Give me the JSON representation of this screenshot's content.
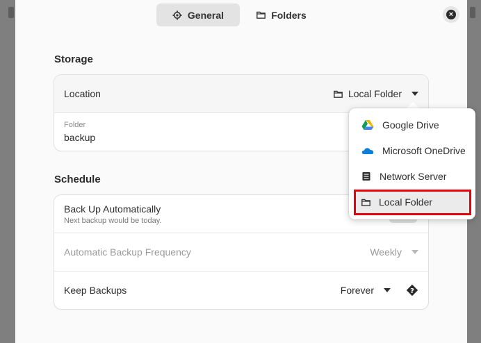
{
  "tabs": [
    {
      "label": "General",
      "icon": "gear-icon"
    },
    {
      "label": "Folders",
      "icon": "folder-icon"
    }
  ],
  "storage": {
    "title": "Storage",
    "location_label": "Location",
    "location_value": "Local Folder",
    "folder_label": "Folder",
    "folder_value": "backup"
  },
  "schedule": {
    "title": "Schedule",
    "auto_label": "Back Up Automatically",
    "auto_sub": "Next backup would be today.",
    "frequency_label": "Automatic Backup Frequency",
    "frequency_value": "Weekly",
    "keep_label": "Keep Backups",
    "keep_value": "Forever"
  },
  "location_menu": {
    "items": [
      {
        "label": "Google Drive",
        "icon": "google-drive-icon"
      },
      {
        "label": "Microsoft OneDrive",
        "icon": "onedrive-icon"
      },
      {
        "label": "Network Server",
        "icon": "server-icon"
      },
      {
        "label": "Local Folder",
        "icon": "folder-icon",
        "highlighted": true
      }
    ]
  },
  "colors": {
    "highlight_box": "#e8000b",
    "gdrive_green": "#0f9d58",
    "gdrive_yellow": "#f4b400",
    "gdrive_blue": "#4285f4",
    "onedrive_blue": "#0a7fd8"
  }
}
